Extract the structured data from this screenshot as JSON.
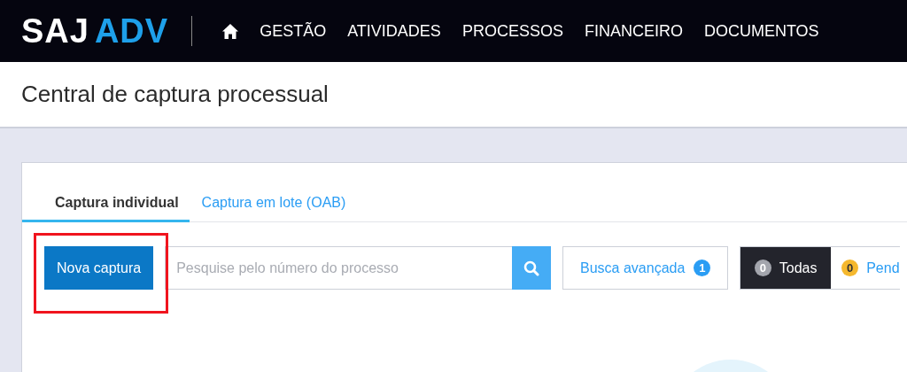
{
  "logo": {
    "primary": "SAJ",
    "secondary": "ADV"
  },
  "nav": {
    "items": [
      "GESTÃO",
      "ATIVIDADES",
      "PROCESSOS",
      "FINANCEIRO",
      "DOCUMENTOS"
    ]
  },
  "page_title": "Central de captura processual",
  "tabs": [
    {
      "label": "Captura individual",
      "selected": true
    },
    {
      "label": "Captura em lote (OAB)",
      "selected": false
    }
  ],
  "toolbar": {
    "new_button": {
      "label": "Nova captura",
      "highlighted": true
    },
    "search": {
      "placeholder": "Pesquise pelo número do processo"
    },
    "advanced_search": {
      "label": "Busca avançada",
      "count": "1"
    },
    "filters": [
      {
        "label": "Todas",
        "count": "0",
        "selected": true,
        "color": "#a3a5ad"
      },
      {
        "label": "Pend",
        "count": "0",
        "selected": false,
        "color": "#f5b82e"
      }
    ]
  }
}
